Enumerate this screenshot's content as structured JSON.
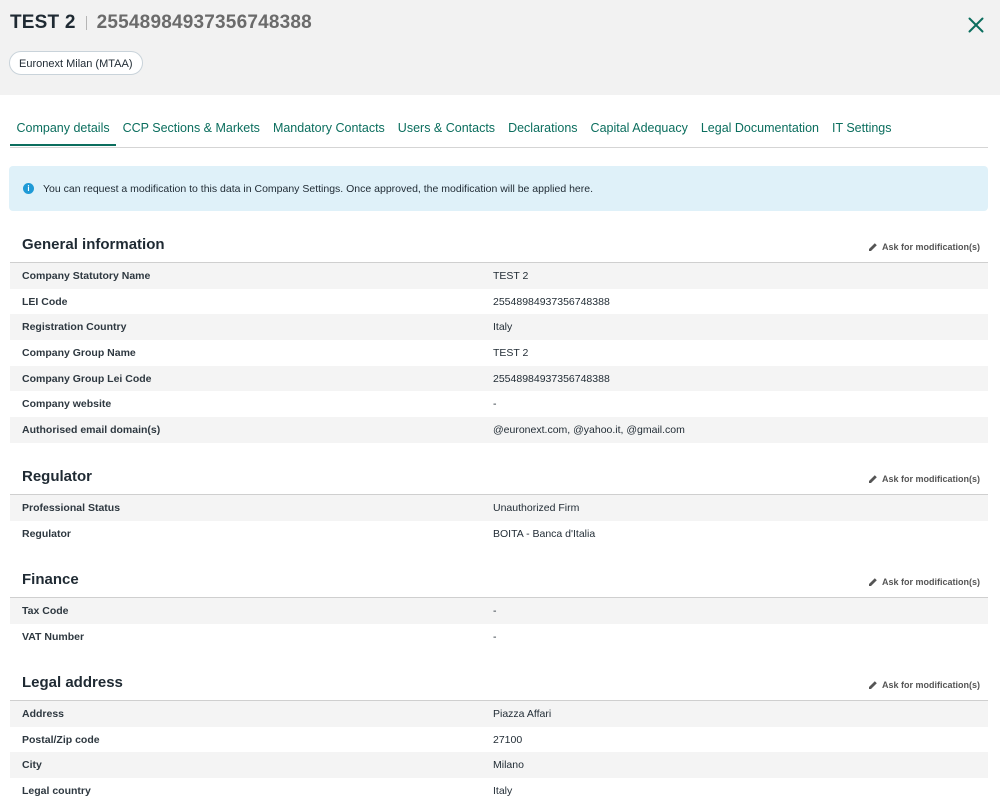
{
  "header": {
    "name": "TEST 2",
    "lei": "25548984937356748388",
    "market_chip": "Euronext Milan (MTAA)"
  },
  "tabs": [
    {
      "label": "Company details",
      "active": true
    },
    {
      "label": "CCP Sections & Markets"
    },
    {
      "label": "Mandatory Contacts"
    },
    {
      "label": "Users & Contacts"
    },
    {
      "label": "Declarations"
    },
    {
      "label": "Capital Adequacy"
    },
    {
      "label": "Legal Documentation"
    },
    {
      "label": "IT Settings"
    }
  ],
  "info_banner": "You can request a modification to this data in Company Settings. Once approved, the modification will be applied here.",
  "ask_label": "Ask for modification(s)",
  "sections": [
    {
      "title": "General information",
      "rows": [
        {
          "label": "Company Statutory Name",
          "value": "TEST 2"
        },
        {
          "label": "LEI Code",
          "value": "25548984937356748388"
        },
        {
          "label": "Registration Country",
          "value": "Italy"
        },
        {
          "label": "Company Group Name",
          "value": "TEST 2"
        },
        {
          "label": "Company Group Lei Code",
          "value": "25548984937356748388"
        },
        {
          "label": "Company website",
          "value": "-"
        },
        {
          "label": "Authorised email domain(s)",
          "value": "@euronext.com, @yahoo.it, @gmail.com"
        }
      ]
    },
    {
      "title": "Regulator",
      "rows": [
        {
          "label": "Professional Status",
          "value": "Unauthorized Firm"
        },
        {
          "label": "Regulator",
          "value": "BOITA - Banca d'Italia"
        }
      ]
    },
    {
      "title": "Finance",
      "rows": [
        {
          "label": "Tax Code",
          "value": "-"
        },
        {
          "label": "VAT Number",
          "value": "-"
        }
      ]
    },
    {
      "title": "Legal address",
      "rows": [
        {
          "label": "Address",
          "value": "Piazza Affari"
        },
        {
          "label": "Postal/Zip code",
          "value": "27100"
        },
        {
          "label": "City",
          "value": "Milano"
        },
        {
          "label": "Legal country",
          "value": "Italy"
        }
      ]
    }
  ],
  "icons": {
    "close": "close-icon",
    "info": "info-icon",
    "edit": "pencil-icon"
  },
  "colors": {
    "accent": "#0b6e5e",
    "banner": "#dff1f9",
    "info": "#1f9ad6"
  }
}
